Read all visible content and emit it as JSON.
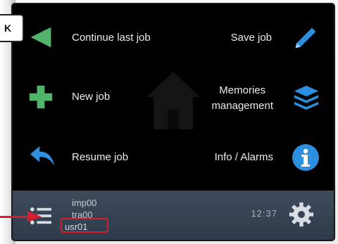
{
  "callout": {
    "text": "K"
  },
  "menu": {
    "continue_last_job": "Continue last job",
    "save_job": "Save job",
    "new_job": "New job",
    "memories_line1": "Memories",
    "memories_line2": "management",
    "resume_job": "Resume job",
    "info_alarms": "Info / Alarms"
  },
  "status": {
    "line1": "imp00",
    "line2": "tra00",
    "line3": "usr01",
    "time": "12:37"
  },
  "colors": {
    "green": "#52b36a",
    "blue": "#2d8fe0",
    "highlight": "#d61d2e"
  }
}
